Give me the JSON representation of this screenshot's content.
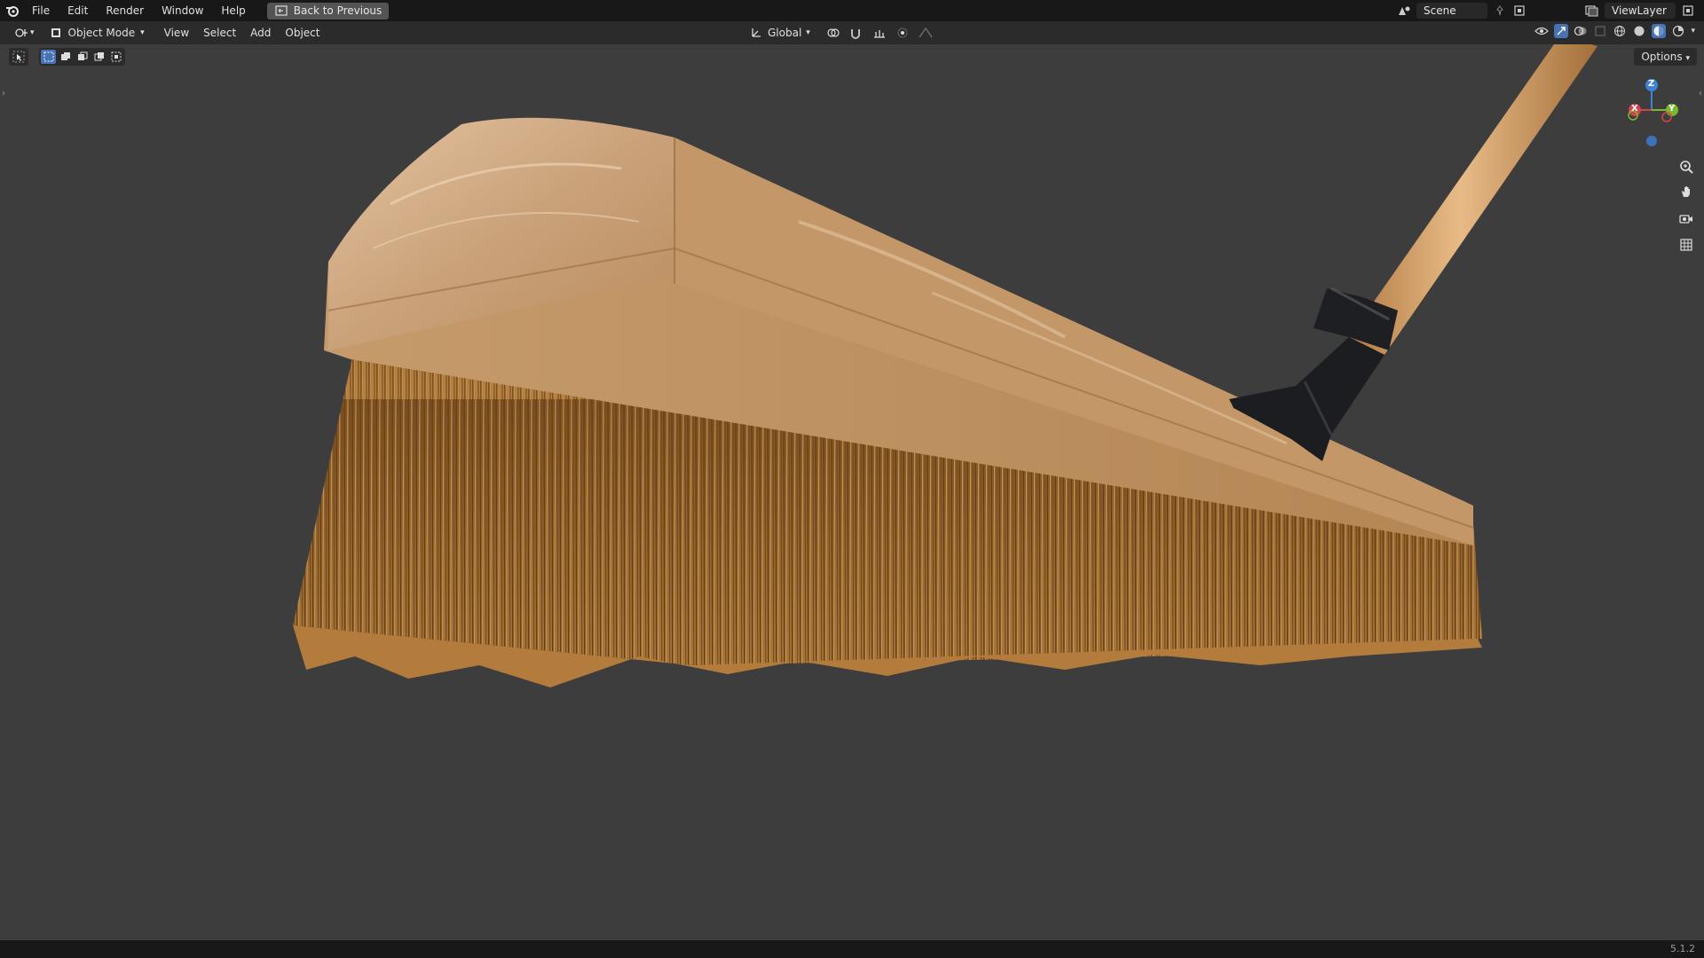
{
  "topbar": {
    "menus": [
      "File",
      "Edit",
      "Render",
      "Window",
      "Help"
    ],
    "back_button": "Back to Previous",
    "scene_label": "Scene",
    "viewlayer_label": "ViewLayer"
  },
  "header": {
    "mode": "Object Mode",
    "menus": [
      "View",
      "Select",
      "Add",
      "Object"
    ],
    "orientation": "Global"
  },
  "options_label": "Options",
  "gizmo": {
    "x": "X",
    "y": "Y",
    "z": "Z"
  },
  "statusbar": {
    "version": "5.1.2"
  },
  "colors": {
    "accent": "#4772b3",
    "viewport_bg": "#3d3d3d",
    "wood": "#c89a62",
    "bristle": "#b07a3a",
    "handle": "#d6a46a",
    "ferrule": "#1e1f22"
  },
  "icons": [
    "blender-logo-icon",
    "back-icon",
    "editor-type-icon",
    "object-mode-icon",
    "orientation-icon",
    "snap-icon",
    "proportional-icon",
    "overlay-icon",
    "shading-solid-icon",
    "zoom-icon",
    "pan-icon",
    "camera-icon",
    "grid-icon"
  ]
}
